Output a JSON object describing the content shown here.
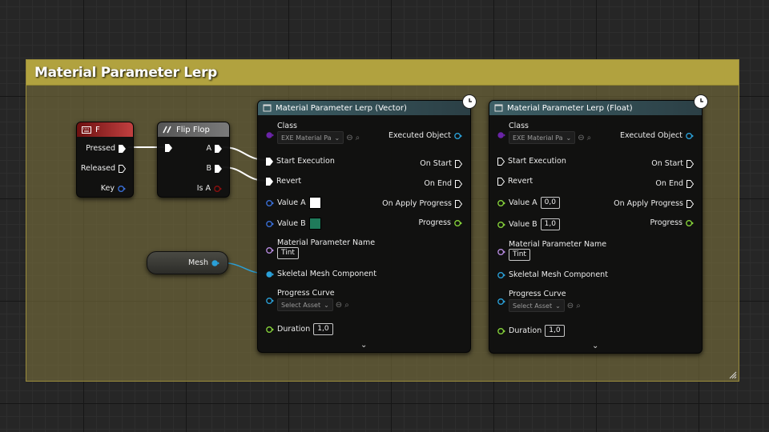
{
  "comment": {
    "title": "Material Parameter Lerp"
  },
  "key_node": {
    "title": "F",
    "pins": {
      "pressed": "Pressed",
      "released": "Released",
      "key": "Key"
    }
  },
  "flipflop_node": {
    "title": "Flip Flop",
    "pins": {
      "a": "A",
      "b": "B",
      "is_a": "Is A"
    }
  },
  "mesh_var": {
    "label": "Mesh"
  },
  "vector_node": {
    "title": "Material Parameter Lerp (Vector)",
    "class_label": "Class",
    "class_value": "EXE Material Pa",
    "executed_object": "Executed Object",
    "start_execution": "Start Execution",
    "on_start": "On Start",
    "revert": "Revert",
    "on_end": "On End",
    "on_apply_progress": "On Apply Progress",
    "value_a": "Value A",
    "value_b": "Value B",
    "value_a_color": "#ffffff",
    "value_b_color": "#1f7a5a",
    "progress": "Progress",
    "material_parameter_name": "Material Parameter Name",
    "param_name_value": "Tint",
    "skeletal_mesh_component": "Skeletal Mesh Component",
    "progress_curve": "Progress Curve",
    "select_asset": "Select Asset",
    "duration": "Duration",
    "duration_value": "1,0"
  },
  "float_node": {
    "title": "Material Parameter Lerp (Float)",
    "class_label": "Class",
    "class_value": "EXE Material Pa",
    "executed_object": "Executed Object",
    "start_execution": "Start Execution",
    "on_start": "On Start",
    "revert": "Revert",
    "on_end": "On End",
    "on_apply_progress": "On Apply Progress",
    "value_a": "Value A",
    "value_a_value": "0,0",
    "value_b": "Value B",
    "value_b_value": "1,0",
    "progress": "Progress",
    "material_parameter_name": "Material Parameter Name",
    "param_name_value": "Tint",
    "skeletal_mesh_component": "Skeletal Mesh Component",
    "progress_curve": "Progress Curve",
    "select_asset": "Select Asset",
    "duration": "Duration",
    "duration_value": "1,0"
  },
  "colors": {
    "comment_header": "#b1a23f",
    "key_header": "#8a1414",
    "macro_header": "#6a6a6a",
    "function_header": "#3d5f66",
    "exec_pin": "#ffffff",
    "object_pin": "#2aa0d8",
    "float_pin": "#86d33a",
    "vector_pin": "#3a6fd8",
    "name_pin": "#b78be0",
    "class_pin": "#6a24a6",
    "bool_pin": "#8b0f0f"
  }
}
